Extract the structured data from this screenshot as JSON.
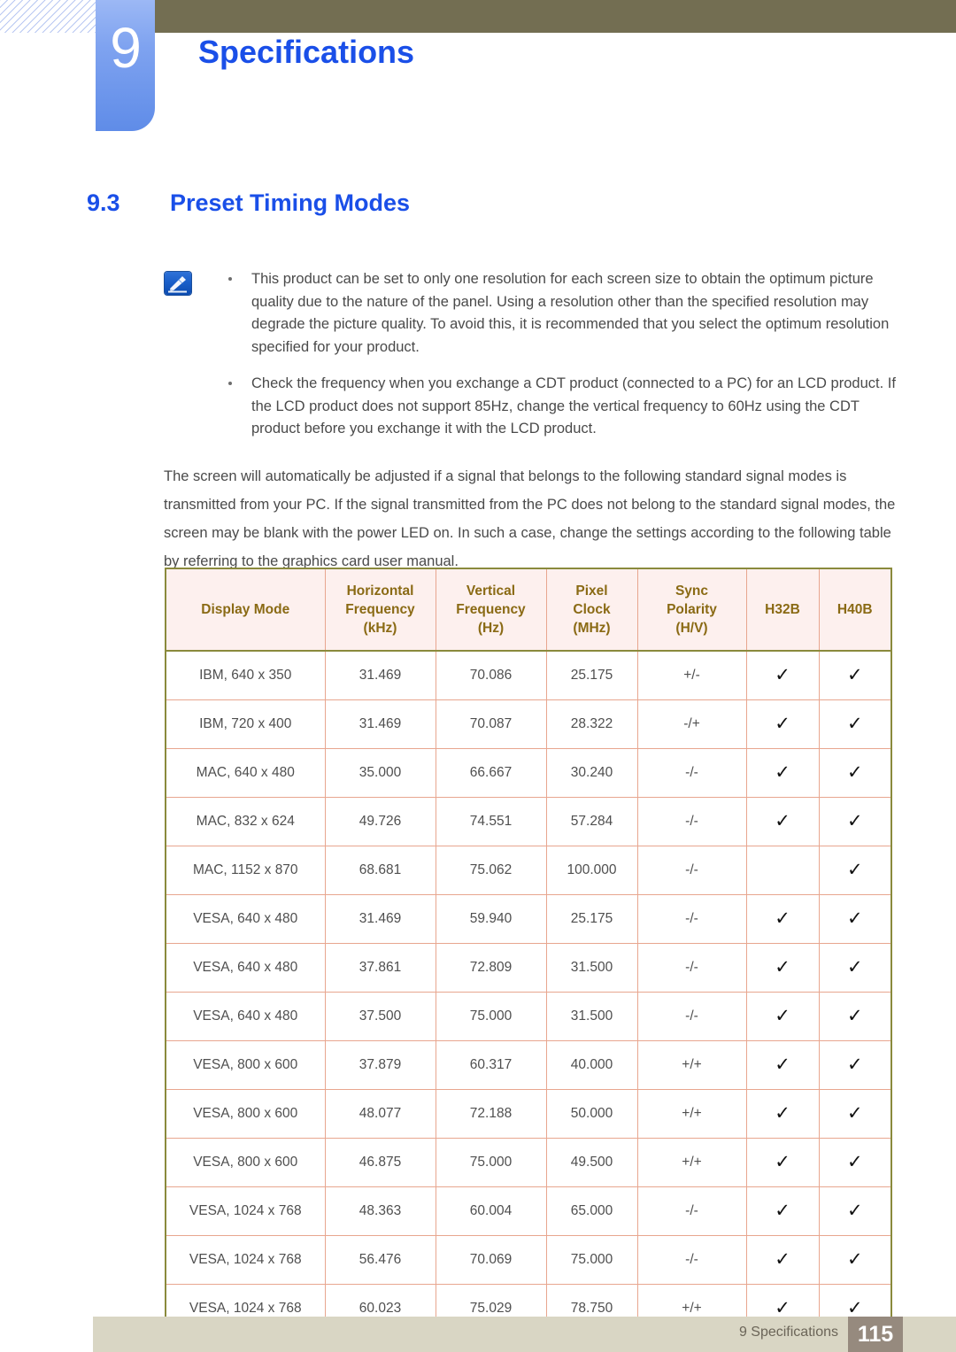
{
  "header": {
    "chapter_number": "9",
    "chapter_title": "Specifications"
  },
  "section": {
    "number": "9.3",
    "title": "Preset Timing Modes"
  },
  "notes": {
    "icon": "note-pen-icon",
    "items": [
      "This product can be set to only one resolution for each screen size to obtain the optimum picture quality due to the nature of the panel. Using a resolution other than the specified resolution may degrade the picture quality. To avoid this, it is recommended that you select the optimum resolution specified for your product.",
      "Check the frequency when you exchange a CDT product (connected to a PC) for an LCD product. If the LCD product does not support 85Hz, change the vertical frequency to 60Hz using the CDT product before you exchange it with the LCD product."
    ]
  },
  "intro_paragraph": "The screen will automatically be adjusted if a signal that belongs to the following standard signal modes is transmitted from your PC. If the signal transmitted from the PC does not belong to the standard signal modes, the screen may be blank with the power LED on. In such a case, change the settings according to the following table by referring to the graphics card user manual.",
  "table": {
    "headers": [
      "Display Mode",
      "Horizontal\nFrequency\n(kHz)",
      "Vertical\nFrequency\n(Hz)",
      "Pixel\nClock\n(MHz)",
      "Sync\nPolarity\n(H/V)",
      "H32B",
      "H40B"
    ],
    "header_lines": [
      [
        "Display Mode"
      ],
      [
        "Horizontal",
        "Frequency",
        "(kHz)"
      ],
      [
        "Vertical",
        "Frequency",
        "(Hz)"
      ],
      [
        "Pixel",
        "Clock",
        "(MHz)"
      ],
      [
        "Sync",
        "Polarity",
        "(H/V)"
      ],
      [
        "H32B"
      ],
      [
        "H40B"
      ]
    ],
    "check_glyph": "✓",
    "rows": [
      {
        "mode": "IBM, 640 x 350",
        "h_freq": "31.469",
        "v_freq": "70.086",
        "pixel_clock": "25.175",
        "sync": "+/-",
        "h32b": "✓",
        "h40b": "✓"
      },
      {
        "mode": "IBM, 720 x 400",
        "h_freq": "31.469",
        "v_freq": "70.087",
        "pixel_clock": "28.322",
        "sync": "-/+",
        "h32b": "✓",
        "h40b": "✓"
      },
      {
        "mode": "MAC, 640 x 480",
        "h_freq": "35.000",
        "v_freq": "66.667",
        "pixel_clock": "30.240",
        "sync": "-/-",
        "h32b": "✓",
        "h40b": "✓"
      },
      {
        "mode": "MAC, 832 x 624",
        "h_freq": "49.726",
        "v_freq": "74.551",
        "pixel_clock": "57.284",
        "sync": "-/-",
        "h32b": "✓",
        "h40b": "✓"
      },
      {
        "mode": "MAC, 1152 x 870",
        "h_freq": "68.681",
        "v_freq": "75.062",
        "pixel_clock": "100.000",
        "sync": "-/-",
        "h32b": "",
        "h40b": "✓"
      },
      {
        "mode": "VESA, 640 x 480",
        "h_freq": "31.469",
        "v_freq": "59.940",
        "pixel_clock": "25.175",
        "sync": "-/-",
        "h32b": "✓",
        "h40b": "✓"
      },
      {
        "mode": "VESA, 640 x 480",
        "h_freq": "37.861",
        "v_freq": "72.809",
        "pixel_clock": "31.500",
        "sync": "-/-",
        "h32b": "✓",
        "h40b": "✓"
      },
      {
        "mode": "VESA, 640 x 480",
        "h_freq": "37.500",
        "v_freq": "75.000",
        "pixel_clock": "31.500",
        "sync": "-/-",
        "h32b": "✓",
        "h40b": "✓"
      },
      {
        "mode": "VESA, 800 x 600",
        "h_freq": "37.879",
        "v_freq": "60.317",
        "pixel_clock": "40.000",
        "sync": "+/+",
        "h32b": "✓",
        "h40b": "✓"
      },
      {
        "mode": "VESA, 800 x 600",
        "h_freq": "48.077",
        "v_freq": "72.188",
        "pixel_clock": "50.000",
        "sync": "+/+",
        "h32b": "✓",
        "h40b": "✓"
      },
      {
        "mode": "VESA, 800 x 600",
        "h_freq": "46.875",
        "v_freq": "75.000",
        "pixel_clock": "49.500",
        "sync": "+/+",
        "h32b": "✓",
        "h40b": "✓"
      },
      {
        "mode": "VESA, 1024 x 768",
        "h_freq": "48.363",
        "v_freq": "60.004",
        "pixel_clock": "65.000",
        "sync": "-/-",
        "h32b": "✓",
        "h40b": "✓"
      },
      {
        "mode": "VESA, 1024 x 768",
        "h_freq": "56.476",
        "v_freq": "70.069",
        "pixel_clock": "75.000",
        "sync": "-/-",
        "h32b": "✓",
        "h40b": "✓"
      },
      {
        "mode": "VESA, 1024 x 768",
        "h_freq": "60.023",
        "v_freq": "75.029",
        "pixel_clock": "78.750",
        "sync": "+/+",
        "h32b": "✓",
        "h40b": "✓"
      }
    ]
  },
  "footer": {
    "chapter_label": "9 Specifications",
    "page_number": "115"
  },
  "colors": {
    "heading_blue": "#1a4fe8",
    "chapter_tab_blue": "#7fa3f0",
    "olive_bar": "#736e52",
    "table_header_bg": "#fdf0ee",
    "table_header_text": "#8a6a14",
    "table_border": "#e8a68f",
    "table_outer_border": "#8a8a3c",
    "footer_bar": "#d9d6c4",
    "footer_page_box": "#968a7e",
    "body_text": "#4a4a4a"
  }
}
